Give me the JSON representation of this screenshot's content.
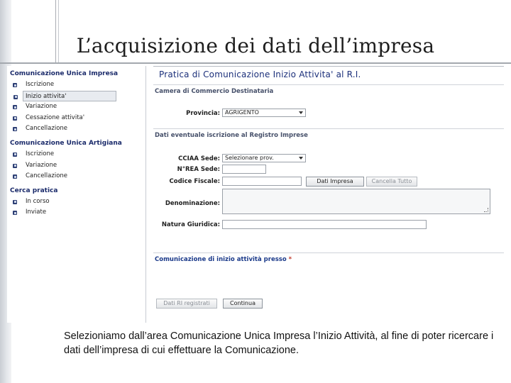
{
  "slide": {
    "title": "L’acquisizione dei dati dell’impresa",
    "caption": "Selezioniamo dall’area Comunicazione Unica Impresa l’Inizio Attività, al fine di poter ricercare i dati dell’impresa di cui effettuare la Comunicazione."
  },
  "sidebar": {
    "sections": [
      {
        "label": "Comunicazione Unica Impresa",
        "items": [
          {
            "label": "Iscrizione",
            "active": false
          },
          {
            "label": "Inizio attivita'",
            "active": true
          },
          {
            "label": "Variazione",
            "active": false
          },
          {
            "label": "Cessazione attivita'",
            "active": false
          },
          {
            "label": "Cancellazione",
            "active": false
          }
        ]
      },
      {
        "label": "Comunicazione Unica Artigiana",
        "items": [
          {
            "label": "Iscrizione",
            "active": false
          },
          {
            "label": "Variazione",
            "active": false
          },
          {
            "label": "Cancellazione",
            "active": false
          }
        ]
      },
      {
        "label": "Cerca pratica",
        "items": [
          {
            "label": "In corso",
            "active": false
          },
          {
            "label": "Inviate",
            "active": false
          }
        ]
      }
    ]
  },
  "form": {
    "heading": "Pratica di Comunicazione Inizio Attivita' al R.I.",
    "camera_section": "Camera di Commercio Destinataria",
    "provincia_label": "Provincia:",
    "provincia_value": "AGRIGENTO",
    "registro_section": "Dati eventuale iscrizione al Registro Imprese",
    "cciaa_label": "CCIAA Sede:",
    "cciaa_value": "Selezionare prov.",
    "nrea_label": "N°REA Sede:",
    "codice_fiscale_label": "Codice Fiscale:",
    "dati_impresa_button": "Dati Impresa",
    "cancella_tutto_button": "Cancella Tutto",
    "denominazione_label": "Denominazione:",
    "natura_giuridica_label": "Natura Giuridica:",
    "comunicazione_section": "Comunicazione di inizio attività presso",
    "required_mark": "*",
    "dati_ri_button": "Dati RI registrati",
    "continua_button": "Continua"
  }
}
